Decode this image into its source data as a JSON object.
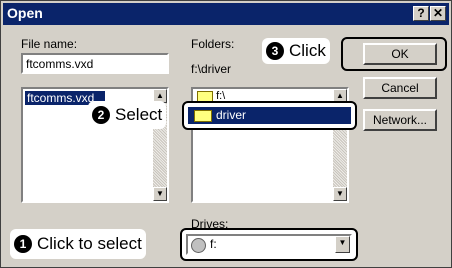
{
  "window": {
    "title": "Open",
    "help_button": "?",
    "close_button": "✕"
  },
  "file_name": {
    "label": "File name:",
    "value": "ftcomms.vxd",
    "list_items": [
      "ftcomms.vxd"
    ]
  },
  "folders": {
    "label": "Folders:",
    "path": "f:\\driver",
    "partial_item": "f:\\",
    "selected_item": "driver"
  },
  "drives": {
    "label": "Drives:",
    "value": "f:"
  },
  "buttons": {
    "ok": "OK",
    "cancel": "Cancel",
    "network": "Network..."
  },
  "callouts": {
    "step1": {
      "number": "1",
      "text": "Click to select"
    },
    "step2": {
      "number": "2",
      "text": "Select"
    },
    "step3": {
      "number": "3",
      "text": "Click"
    }
  },
  "colors": {
    "titlebar": "#0a246a",
    "selection": "#0a246a",
    "dialog_face": "#d4d0c8"
  }
}
